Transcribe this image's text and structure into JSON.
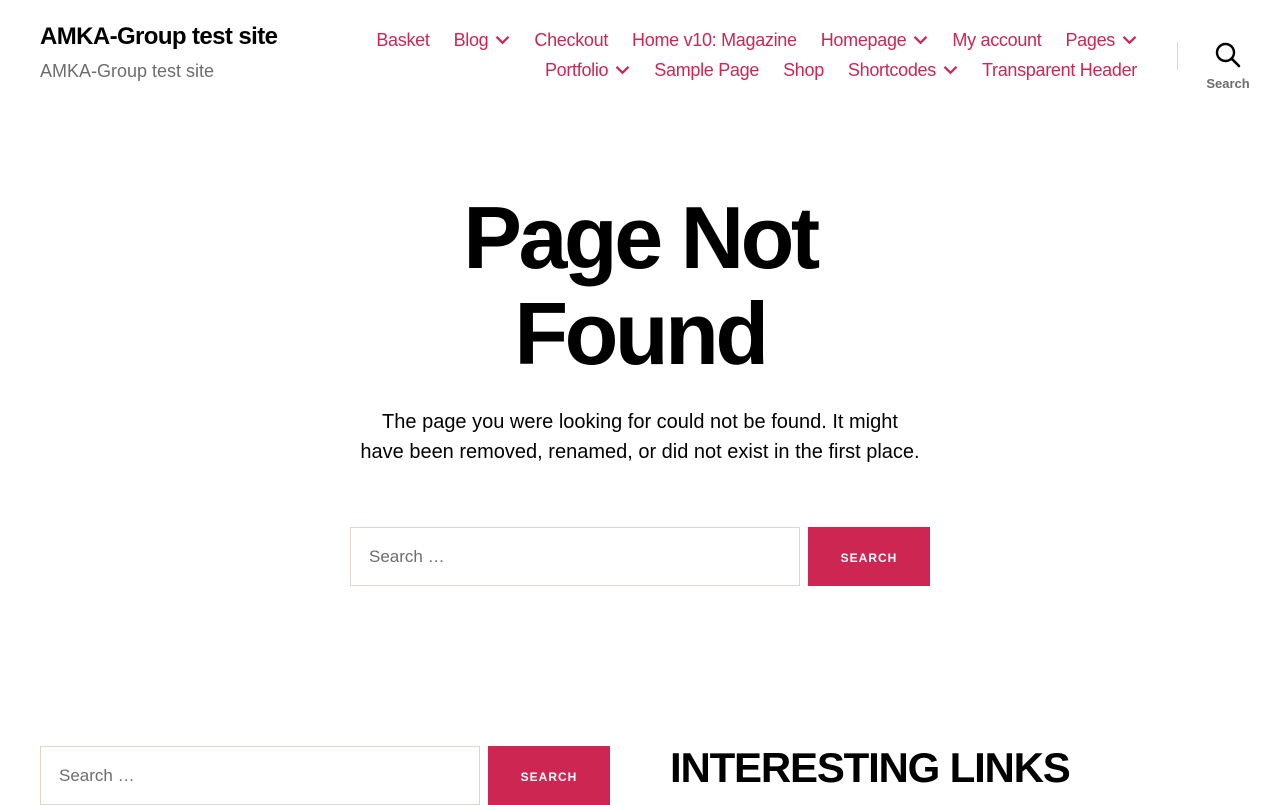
{
  "header": {
    "site_title": "AMKA-Group test site",
    "site_description": "AMKA-Group test site",
    "search_toggle_label": "Search"
  },
  "nav": {
    "row1": [
      {
        "label": "Basket",
        "has_submenu": false
      },
      {
        "label": "Blog",
        "has_submenu": true
      },
      {
        "label": "Checkout",
        "has_submenu": false
      },
      {
        "label": "Home v10: Magazine",
        "has_submenu": false
      },
      {
        "label": "Homepage",
        "has_submenu": true
      },
      {
        "label": "My account",
        "has_submenu": false
      },
      {
        "label": "Pages",
        "has_submenu": true
      }
    ],
    "row2": [
      {
        "label": "Portfolio",
        "has_submenu": true
      },
      {
        "label": "Sample Page",
        "has_submenu": false
      },
      {
        "label": "Shop",
        "has_submenu": false
      },
      {
        "label": "Shortcodes",
        "has_submenu": true
      },
      {
        "label": "Transparent Header",
        "has_submenu": false
      }
    ]
  },
  "main": {
    "title_line1": "Page Not",
    "title_line2": "Found",
    "intro": "The page you were looking for could not be found. It might have been removed, renamed, or did not exist in the first place.",
    "search": {
      "placeholder": "Search …",
      "button_label": "Search"
    }
  },
  "footer": {
    "search": {
      "placeholder": "Search …",
      "button_label": "Search"
    },
    "widget_title": "INTERESTING LINKS"
  },
  "colors": {
    "accent": "#cd2653",
    "text": "#000000",
    "secondary_text": "#6d6d6d",
    "border": "#dcd7ca",
    "background": "#ffffff"
  },
  "icons": {
    "submenu": "chevron-down-icon",
    "search": "search-icon"
  }
}
